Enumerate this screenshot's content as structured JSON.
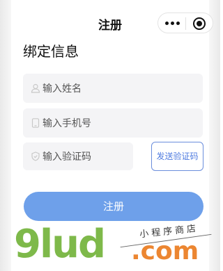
{
  "nav": {
    "title": "注册",
    "capsule": {
      "more_icon": "more-dots-icon",
      "close_icon": "target-circle-icon"
    }
  },
  "section": {
    "title": "绑定信息"
  },
  "form": {
    "name_placeholder": "输入姓名",
    "phone_placeholder": "输入手机号",
    "code_placeholder": "输入验证码",
    "send_code_label": "发送验证码",
    "submit_label": "注册"
  },
  "icons": {
    "name": "person-icon",
    "phone": "phone-icon",
    "code": "shield-icon"
  },
  "colors": {
    "primary_button": "#6ea0ea",
    "send_button_border": "#6a8ddc",
    "send_button_text": "#4f7be0",
    "input_background": "#f4f4f6"
  },
  "watermark": {
    "brand": "9lud",
    "suffix": ".com",
    "script": "小程序商店",
    "color_green": "#7eb94a",
    "color_orange": "#ec8631"
  }
}
